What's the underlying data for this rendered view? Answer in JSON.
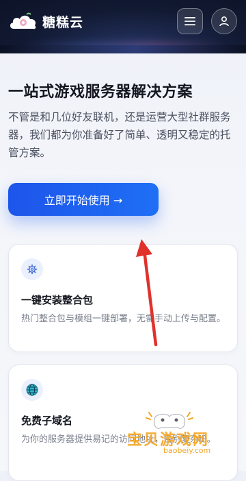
{
  "header": {
    "brand": "糖糕云",
    "menu_icon": "hamburger-icon",
    "user_icon": "user-icon",
    "logo_icon": "cloud-logo-icon"
  },
  "hero": {
    "title": "一站式游戏服务器解决方案",
    "description": "不管是和几位好友联机，还是运营大型社群服务器，我们都为你准备好了简单、透明又稳定的托管方案。",
    "cta_label": "立即开始使用 →"
  },
  "features": [
    {
      "icon": "gear-icon",
      "title": "一键安装整合包",
      "description": "热门整合包与模组一键部署，无需手动上传与配置。"
    },
    {
      "icon": "globe-icon",
      "title": "免费子域名",
      "description": "为你的服务器提供易记的访问地址，告别复杂IP。"
    }
  ],
  "watermark": {
    "text": "宝贝游戏网",
    "url": "baobeiy.com"
  },
  "colors": {
    "accent": "#1f63f0",
    "annotation": "#e0322b",
    "watermark": "#f5a623"
  }
}
